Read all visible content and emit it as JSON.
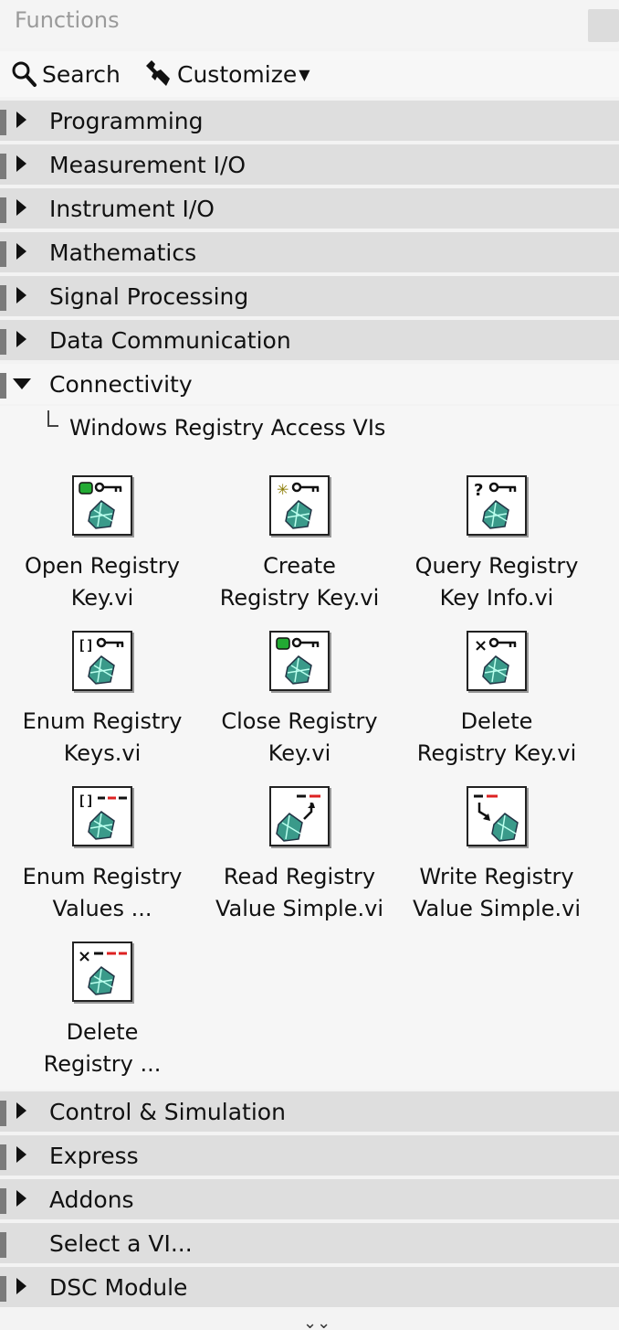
{
  "window": {
    "title": "Functions"
  },
  "toolbar": {
    "search_label": "Search",
    "customize_label": "Customize"
  },
  "categories": [
    {
      "label": "Programming"
    },
    {
      "label": "Measurement I/O"
    },
    {
      "label": "Instrument I/O"
    },
    {
      "label": "Mathematics"
    },
    {
      "label": "Signal Processing"
    },
    {
      "label": "Data Communication"
    },
    {
      "label": "Connectivity"
    },
    {
      "label": "Control & Simulation"
    },
    {
      "label": "Express"
    },
    {
      "label": "Addons"
    },
    {
      "label": "Select a VI..."
    },
    {
      "label": "DSC Module"
    }
  ],
  "subpalette": {
    "label": "Windows Registry Access VIs",
    "items": [
      {
        "line1": "Open Registry",
        "line2": "Key.vi",
        "icon": "open-registry-key-icon"
      },
      {
        "line1": "Create",
        "line2": "Registry Key.vi",
        "icon": "create-registry-key-icon"
      },
      {
        "line1": "Query Registry",
        "line2": "Key Info.vi",
        "icon": "query-registry-key-icon"
      },
      {
        "line1": "Enum Registry",
        "line2": "Keys.vi",
        "icon": "enum-registry-keys-icon"
      },
      {
        "line1": "Close Registry",
        "line2": "Key.vi",
        "icon": "close-registry-key-icon"
      },
      {
        "line1": "Delete",
        "line2": "Registry Key.vi",
        "icon": "delete-registry-key-icon"
      },
      {
        "line1": "Enum Registry",
        "line2": "Values ...",
        "icon": "enum-registry-values-icon"
      },
      {
        "line1": "Read Registry",
        "line2": "Value Simple.vi",
        "icon": "read-registry-value-icon"
      },
      {
        "line1": "Write Registry",
        "line2": "Value Simple.vi",
        "icon": "write-registry-value-icon"
      },
      {
        "line1": "Delete",
        "line2": "Registry ...",
        "icon": "delete-registry-value-icon"
      }
    ]
  },
  "footer": {
    "collapse_glyph": "⌄⌄"
  },
  "colors": {
    "category_bg": "#dedede",
    "open_bg": "#f6f6f6",
    "key_green": "#22aa33",
    "value_red": "#dd2222",
    "globe_teal": "#3a9a8a"
  }
}
